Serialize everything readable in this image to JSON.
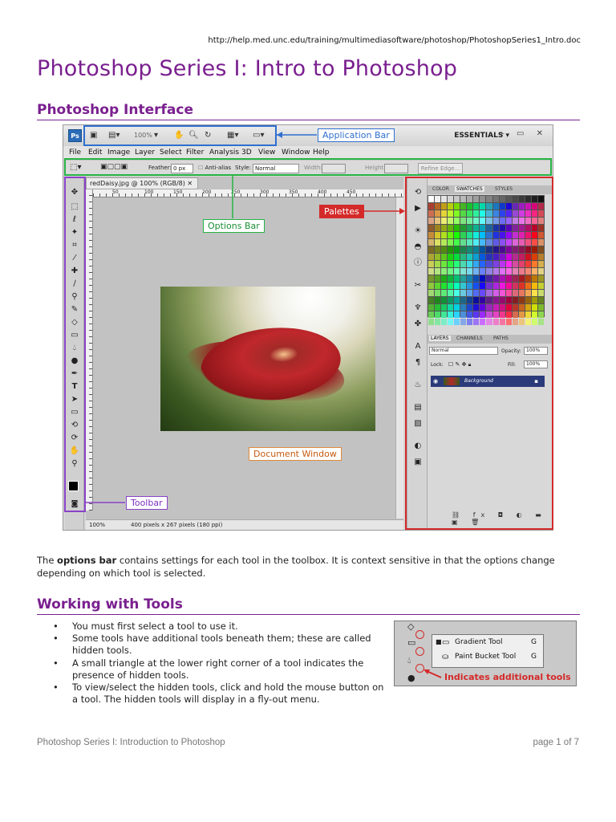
{
  "header": {
    "url": "http://help.med.unc.edu/training/multimediasoftware/photoshop/PhotoshopSeries1_Intro.doc",
    "title": "Photoshop Series I: Intro to Photoshop"
  },
  "sections": {
    "interface_heading": "Photoshop Interface",
    "tools_heading": "Working with Tools"
  },
  "screenshot": {
    "app_bar": {
      "logo": "Ps",
      "zoom": "100%",
      "workspace": "ESSENTIALS ▾",
      "window_controls": "– ▭ ✕"
    },
    "menu": [
      "File",
      "Edit",
      "Image",
      "Layer",
      "Select",
      "Filter",
      "Analysis",
      "3D",
      "View",
      "Window",
      "Help"
    ],
    "options_bar": {
      "feather_label": "Feather:",
      "feather_value": "0 px",
      "antialias_label": "Anti-alias",
      "style_label": "Style:",
      "style_value": "Normal",
      "width_label": "Width:",
      "height_label": "Height:",
      "refine_button": "Refine Edge..."
    },
    "document": {
      "tab": "redDaisy.jpg @ 100% (RGB/8)",
      "ruler_labels": [
        "50",
        "100",
        "150",
        "200",
        "250",
        "300",
        "350",
        "400",
        "450"
      ],
      "status_zoom": "100%",
      "status_info": "400 pixels x 267 pixels (180 ppi)"
    },
    "palettes": {
      "color_tabs": [
        "COLOR",
        "SWATCHES",
        "STYLES"
      ],
      "layer_tabs": [
        "LAYERS",
        "CHANNELS",
        "PATHS"
      ],
      "blend_mode": "Normal",
      "opacity_label": "Opacity:",
      "opacity_value": "100%",
      "lock_label": "Lock:",
      "fill_label": "Fill:",
      "fill_value": "100%",
      "layer_name": "Background"
    },
    "callouts": {
      "application_bar": "Application Bar",
      "options_bar": "Options Bar",
      "palettes": "Palettes",
      "document_window": "Document Window",
      "toolbar": "Toolbar"
    }
  },
  "paragraph": {
    "prefix": "The ",
    "bold": "options bar",
    "suffix": " contains settings for each tool in the toolbox. It is context sensitive in that the options change depending on which tool is selected."
  },
  "bullets": [
    "You must first select a tool to use it.",
    "Some tools have additional tools beneath them; these are called hidden tools.",
    "A small triangle at the lower right corner of a tool indicates the presence of hidden tools.",
    "To view/select the hidden tools, click and hold the mouse button on a tool.  The hidden tools will display in a fly-out menu."
  ],
  "tools_inset": {
    "items": [
      {
        "label": "Gradient Tool",
        "key": "G"
      },
      {
        "label": "Paint Bucket Tool",
        "key": "G"
      }
    ],
    "note": "Indicates additional tools"
  },
  "footer": {
    "left": "Photoshop Series I: Introduction to Photoshop",
    "right": "page 1 of 7"
  },
  "colors": {
    "heading": "#7a1f8f",
    "application_bar_callout": "#2f6fd0",
    "options_bar_callout": "#27b345",
    "toolbar_callout": "#8a43c8",
    "palettes_callout": "#d42a2a",
    "document_window_callout": "#e08a3c"
  }
}
